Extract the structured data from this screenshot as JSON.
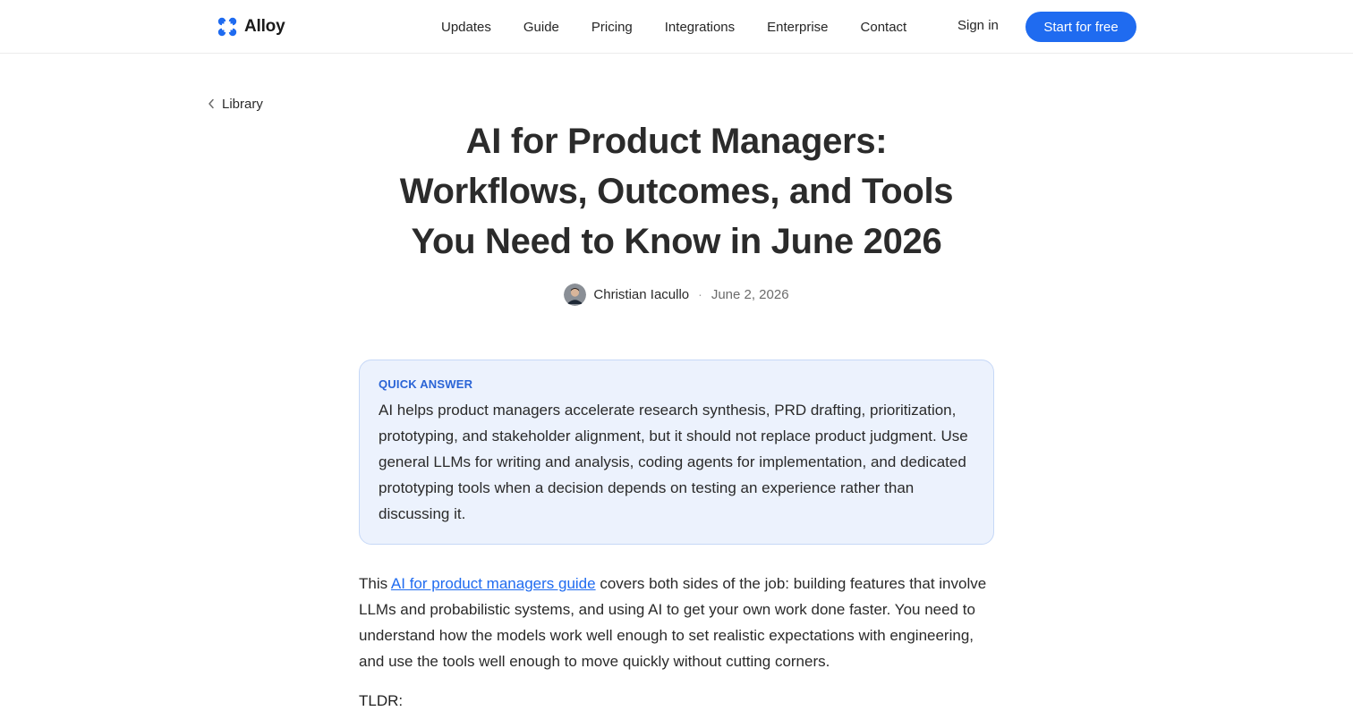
{
  "header": {
    "logo_text": "Alloy",
    "brand_color": "#1f6bf0",
    "nav": [
      "Updates",
      "Guide",
      "Pricing",
      "Integrations",
      "Enterprise",
      "Contact"
    ],
    "sign_in": "Sign in",
    "cta": "Start for free"
  },
  "breadcrumb": {
    "icon": "chevron-left-icon",
    "label": "Library"
  },
  "article": {
    "title_lines": [
      "AI for Product Managers:",
      "Workflows, Outcomes, and Tools",
      "You Need to Know in June 2026"
    ],
    "author": "Christian Iacullo",
    "separator": "·",
    "date": "June 2, 2026",
    "quick_answer": {
      "label": "QUICK ANSWER",
      "text": "AI helps product managers accelerate research synthesis, PRD drafting, prioritization, prototyping, and stakeholder alignment, but it should not replace product judgment. Use general LLMs for writing and analysis, coding agents for implementation, and dedicated prototyping tools when a decision depends on testing an experience rather than discussing it."
    },
    "intro": {
      "before_link": "This ",
      "link_text": "AI for product managers guide",
      "after_link": " covers both sides of the job: building features that involve LLMs and probabilistic systems, and using AI to get your own work done faster. You need to understand how the models work well enough to set realistic expectations with engineering, and use the tools well enough to move quickly without cutting corners."
    },
    "tldr_label": "TLDR:"
  }
}
